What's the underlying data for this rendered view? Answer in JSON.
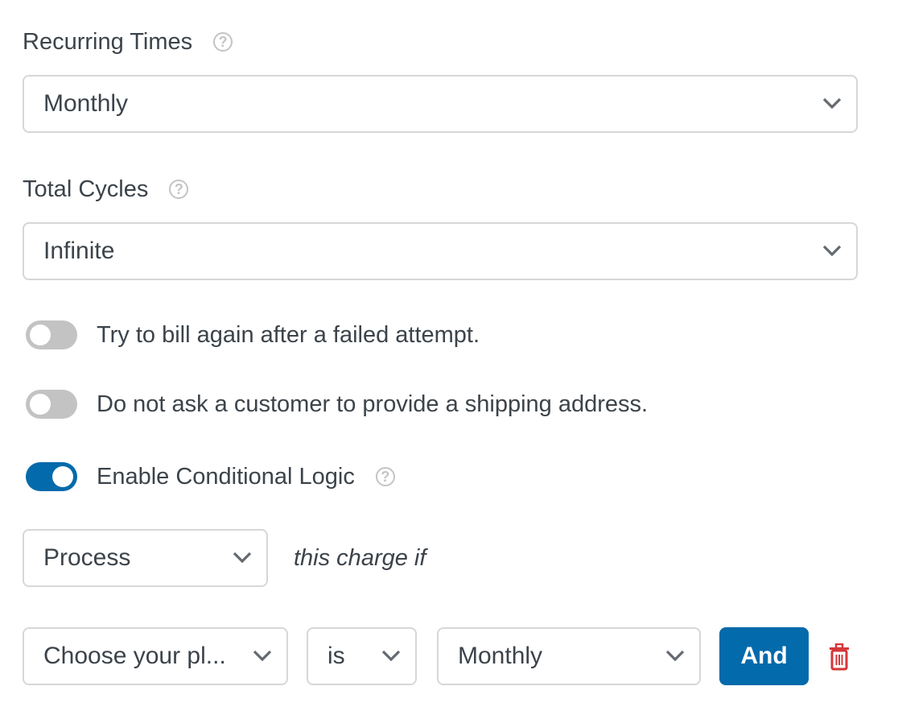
{
  "recurring_times": {
    "label": "Recurring Times",
    "help_icon": "question-circle-icon",
    "value": "Monthly"
  },
  "total_cycles": {
    "label": "Total Cycles",
    "help_icon": "question-circle-icon",
    "value": "Infinite"
  },
  "toggles": [
    {
      "label": "Try to bill again after a failed attempt.",
      "enabled": false
    },
    {
      "label": "Do not ask a customer to provide a shipping address.",
      "enabled": false
    },
    {
      "label": "Enable Conditional Logic",
      "enabled": true,
      "help_icon": "question-circle-icon"
    }
  ],
  "conditional": {
    "action_value": "Process",
    "action_suffix": "this charge if",
    "rule": {
      "field_value": "Choose your pl...",
      "operator_value": "is",
      "value": "Monthly",
      "and_label": "And",
      "delete_icon": "trash-icon"
    }
  },
  "colors": {
    "accent": "#036aab",
    "toggle_off": "#c3c3c3",
    "delete": "#d63638",
    "border": "#d7d7d7",
    "text": "#3c434a",
    "help": "#c3c4c7"
  }
}
